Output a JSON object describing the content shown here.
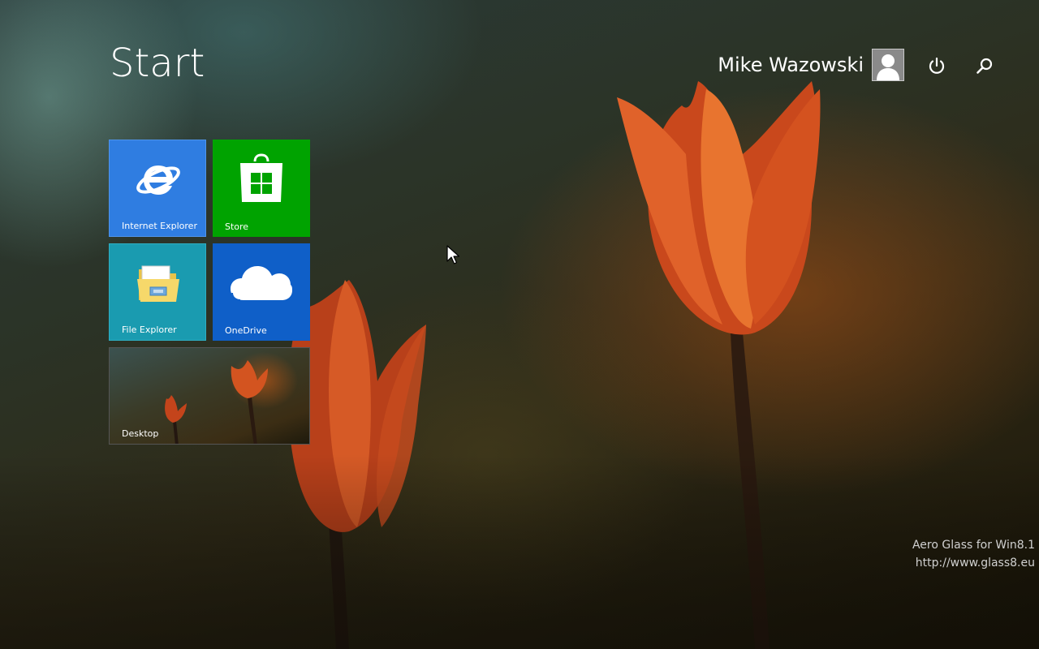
{
  "header": {
    "title": "Start",
    "user_name": "Mike Wazowski"
  },
  "icons": {
    "avatar": "user-avatar-icon",
    "power": "power-icon",
    "search": "search-icon",
    "ie": "internet-explorer-icon",
    "store": "store-bag-icon",
    "explorer": "folder-icon",
    "onedrive": "cloud-icon"
  },
  "tiles": [
    {
      "label": "Internet Explorer",
      "color": "#2f7de1"
    },
    {
      "label": "Store",
      "color": "#00a300"
    },
    {
      "label": "File Explorer",
      "color": "#1a9bb0"
    },
    {
      "label": "OneDrive",
      "color": "#0f5fc8"
    },
    {
      "label": "Desktop",
      "color": "#3a3a26"
    }
  ],
  "watermark": {
    "line1": "Aero Glass for Win8.1",
    "line2": "http://www.glass8.eu"
  }
}
